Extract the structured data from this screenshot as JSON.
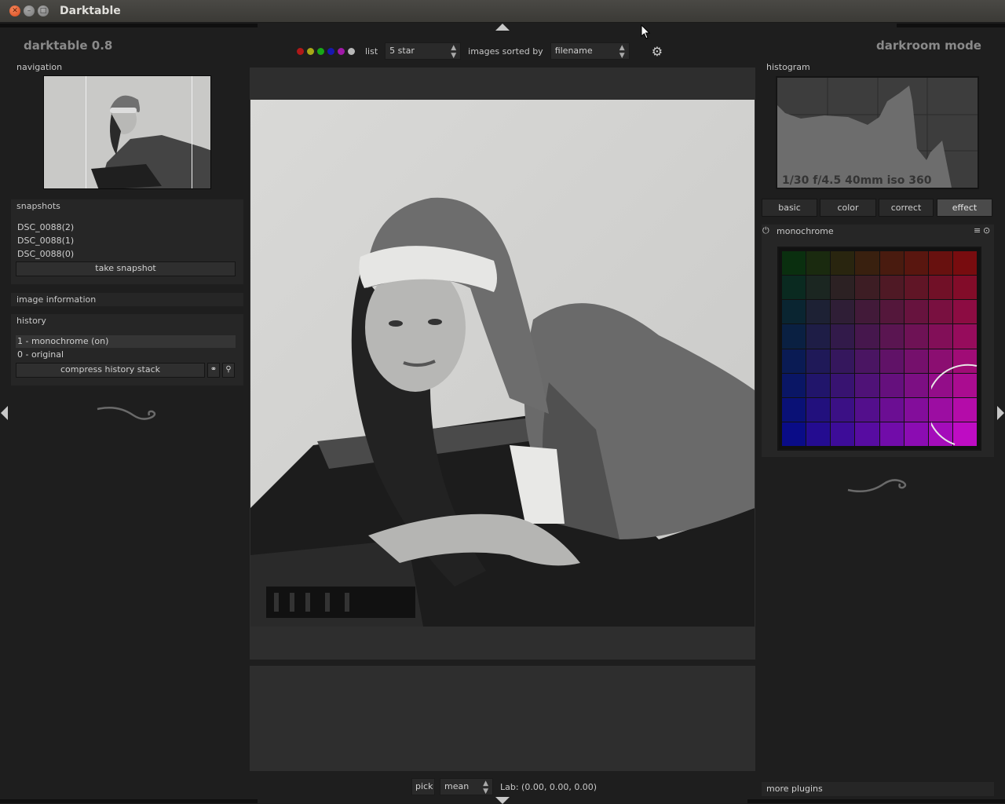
{
  "window": {
    "title": "Darktable"
  },
  "app": {
    "name": "darktable 0.8",
    "mode": "darkroom mode"
  },
  "toolbar": {
    "color_labels": [
      "#b01818",
      "#a8a818",
      "#18a818",
      "#1818b0",
      "#a018a8",
      "#b8b8b8"
    ],
    "list_label": "list",
    "list_value": "5 star",
    "sort_label": "images sorted by",
    "sort_value": "filename"
  },
  "left": {
    "navigation_title": "navigation",
    "snapshots_title": "snapshots",
    "snapshots": [
      "DSC_0088(2)",
      "DSC_0088(1)",
      "DSC_0088(0)"
    ],
    "take_snapshot": "take snapshot",
    "image_information": "image information",
    "history_title": "history",
    "history": [
      "1 - monochrome (on)",
      "0 - original"
    ],
    "compress_history": "compress history stack"
  },
  "right": {
    "histogram_title": "histogram",
    "exif": "1/30 f/4.5 40mm iso 360",
    "tabs": [
      "basic",
      "color",
      "correct",
      "effect"
    ],
    "active_tab": "effect",
    "plugin_title": "monochrome",
    "more_plugins": "more plugins"
  },
  "bottom": {
    "pick_label": "pick",
    "mode_value": "mean",
    "lab_readout": "Lab: (0.00, 0.00, 0.00)"
  }
}
